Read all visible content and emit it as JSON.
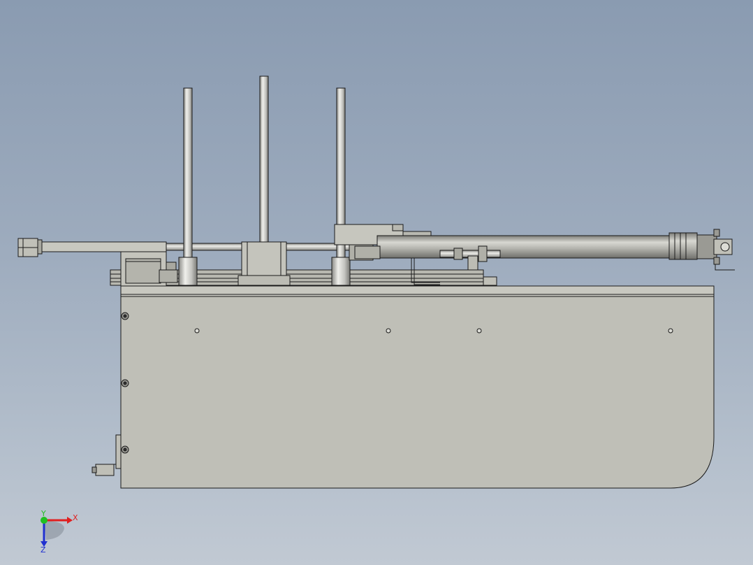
{
  "viewport": {
    "background_top": "#8a9bb1",
    "background_bottom": "#c1c9d3"
  },
  "model": {
    "view": "front",
    "part_fill": "#bfbfb7",
    "edge_color": "#1a1a1a",
    "metal_light": "#e0e0dc",
    "metal_dark": "#8a8a86"
  },
  "triad": {
    "x_label": "X",
    "y_label": "Y",
    "z_label": "Z",
    "x_color": "#e02020",
    "y_color": "#20c020",
    "z_color": "#2030d0"
  }
}
